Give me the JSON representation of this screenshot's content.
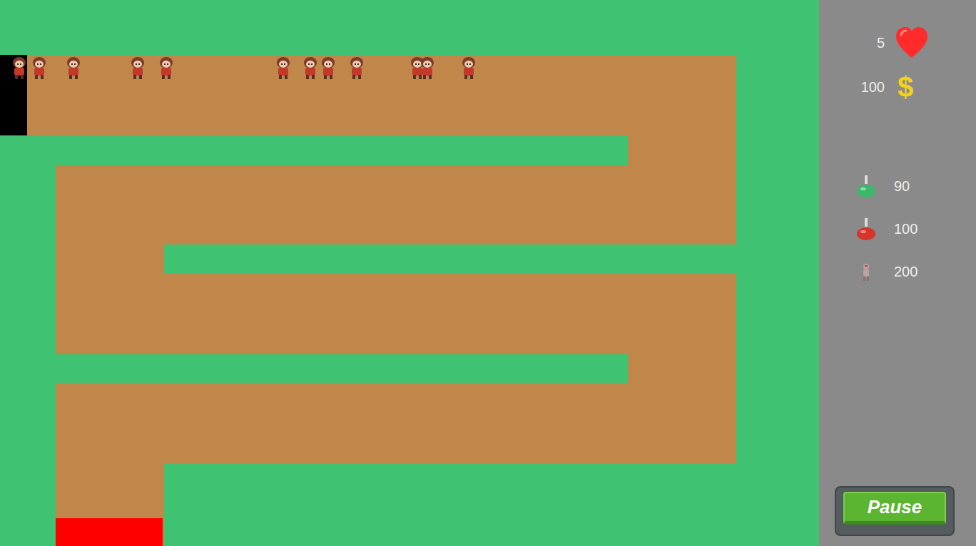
{
  "hud": {
    "lives": "5",
    "money": "100",
    "money_symbol": "$"
  },
  "towers": [
    {
      "cost": "90",
      "kind": "potion",
      "color": "#3cb86a"
    },
    {
      "cost": "100",
      "kind": "potion",
      "color": "#d8352a"
    },
    {
      "cost": "200",
      "kind": "figure",
      "color": "#b9a3a3"
    }
  ],
  "buttons": {
    "pause": "Pause"
  }
}
